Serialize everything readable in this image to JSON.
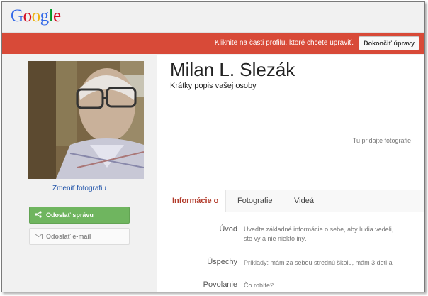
{
  "header": {
    "logo": [
      "G",
      "o",
      "o",
      "g",
      "l",
      "e"
    ],
    "logo_colors": [
      "#3369e8",
      "#d50f25",
      "#eeb211",
      "#3369e8",
      "#009925",
      "#d50f25"
    ]
  },
  "edit_bar": {
    "message": "Kliknite na časti profilu, ktoré chcete upraviť.",
    "done_label": "Dokončiť úpravy",
    "color": "#d84a38"
  },
  "sidebar": {
    "change_photo": "Zmeniť fotografiu",
    "send_message": "Odoslať správu",
    "send_email": "Odoslať e-mail"
  },
  "profile": {
    "name": "Milan L. Slezák",
    "short_description": "Krátky popis vašej osoby",
    "add_photos": "Tu pridajte fotografie"
  },
  "tabs": [
    "Informácie o",
    "Fotografie",
    "Videá"
  ],
  "about": {
    "rows": [
      {
        "label": "Úvod",
        "value": "Uveďte základné informácie o sebe, aby ľudia vedeli,\nste vy a nie niekto iný."
      },
      {
        "label": "Úspechy",
        "value": "Príklady: mám za sebou strednú školu, mám 3 deti a"
      },
      {
        "label": "Povolanie",
        "value": "Čo robíte?"
      }
    ]
  }
}
